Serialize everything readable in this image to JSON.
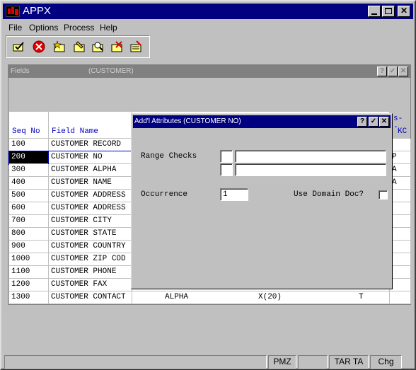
{
  "app": {
    "title": "APPX"
  },
  "menu": {
    "items": [
      {
        "label": "File"
      },
      {
        "label": "Options"
      },
      {
        "label": "Process"
      },
      {
        "label": "Help"
      }
    ]
  },
  "toolbar": {
    "icons": [
      "confirm-icon",
      "cancel-icon",
      "add-icon",
      "change-icon",
      "inquire-icon",
      "delete-icon",
      "scan-icon"
    ]
  },
  "fields_window": {
    "title": "Fields",
    "context": "(CUSTOMER)",
    "headers": {
      "seq": "Seq No",
      "name": "Field Name",
      "kc_top": "s--",
      "kc": "KC"
    },
    "rows": [
      {
        "seq": "100",
        "name": "CUSTOMER RECORD",
        "type": "",
        "format": "",
        "t": "",
        "kc": ""
      },
      {
        "seq": "200",
        "name": "CUSTOMER NO",
        "type": "",
        "format": "",
        "t": "",
        "kc": "P"
      },
      {
        "seq": "300",
        "name": "CUSTOMER ALPHA",
        "type": "",
        "format": "",
        "t": "",
        "kc": "A"
      },
      {
        "seq": "400",
        "name": "CUSTOMER NAME",
        "type": "",
        "format": "",
        "t": "",
        "kc": "A"
      },
      {
        "seq": "500",
        "name": "CUSTOMER ADDRESS",
        "type": "",
        "format": "",
        "t": "",
        "kc": ""
      },
      {
        "seq": "600",
        "name": "CUSTOMER ADDRESS",
        "type": "",
        "format": "",
        "t": "",
        "kc": ""
      },
      {
        "seq": "700",
        "name": "CUSTOMER CITY",
        "type": "",
        "format": "",
        "t": "",
        "kc": ""
      },
      {
        "seq": "800",
        "name": "CUSTOMER STATE",
        "type": "",
        "format": "",
        "t": "",
        "kc": ""
      },
      {
        "seq": "900",
        "name": "CUSTOMER COUNTRY",
        "type": "",
        "format": "",
        "t": "",
        "kc": ""
      },
      {
        "seq": "1000",
        "name": "CUSTOMER ZIP COD",
        "type": "",
        "format": "",
        "t": "",
        "kc": ""
      },
      {
        "seq": "1100",
        "name": "CUSTOMER PHONE",
        "type": "",
        "format": "",
        "t": "",
        "kc": ""
      },
      {
        "seq": "1200",
        "name": "CUSTOMER FAX",
        "type": "",
        "format": "",
        "t": "",
        "kc": ""
      },
      {
        "seq": "1300",
        "name": "CUSTOMER CONTACT",
        "type": "ALPHA",
        "format": "X(20)",
        "t": "T",
        "kc": ""
      }
    ]
  },
  "dialog": {
    "title": "Add'l Attributes (CUSTOMER NO)",
    "range_checks_label": "Range Checks",
    "range_flag_1": "",
    "range_value_1": "",
    "range_flag_2": "",
    "range_value_2": "",
    "occurrence_label": "Occurrence",
    "occurrence_value": "1",
    "use_domain_doc_label": "Use Domain Doc?",
    "use_domain_doc_checked": false
  },
  "statusbar": {
    "cells": [
      "",
      "",
      "PMZ",
      "",
      "TAR TA",
      "Chg"
    ]
  },
  "colors": {
    "title_active": "#000080",
    "title_inactive": "#808080",
    "face": "#c0c0c0",
    "header_text": "#0000c0"
  }
}
